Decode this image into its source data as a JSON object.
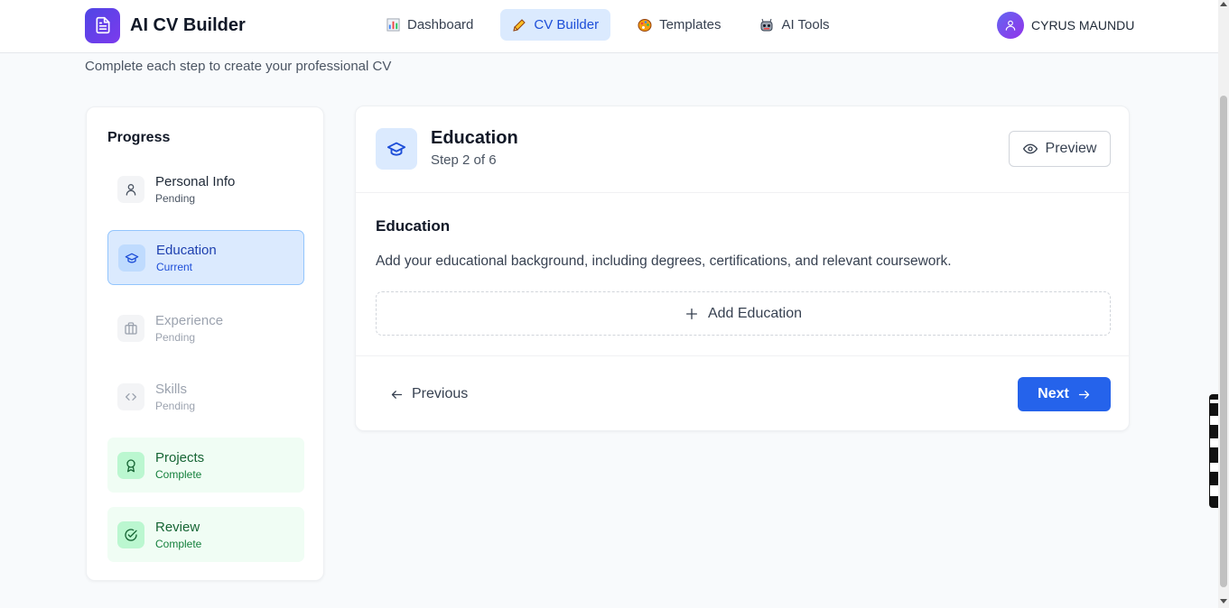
{
  "app": {
    "title": "AI CV Builder"
  },
  "nav": {
    "items": [
      {
        "label": "Dashboard",
        "icon": "bar-chart-icon",
        "active": false
      },
      {
        "label": "CV Builder",
        "icon": "pencil-icon",
        "active": true
      },
      {
        "label": "Templates",
        "icon": "palette-icon",
        "active": false
      },
      {
        "label": "AI Tools",
        "icon": "robot-icon",
        "active": false
      }
    ]
  },
  "user": {
    "name": "CYRUS MAUNDU"
  },
  "page": {
    "subtitle": "Complete each step to create your professional CV"
  },
  "sidebar": {
    "title": "Progress",
    "steps": [
      {
        "label": "Personal Info",
        "status": "Pending",
        "icon": "user-icon",
        "state": "pending"
      },
      {
        "label": "Education",
        "status": "Current",
        "icon": "graduation-cap-icon",
        "state": "current"
      },
      {
        "label": "Experience",
        "status": "Pending",
        "icon": "briefcase-icon",
        "state": "pending"
      },
      {
        "label": "Skills",
        "status": "Pending",
        "icon": "code-icon",
        "state": "pending"
      },
      {
        "label": "Projects",
        "status": "Complete",
        "icon": "award-icon",
        "state": "complete"
      },
      {
        "label": "Review",
        "status": "Complete",
        "icon": "check-circle-icon",
        "state": "complete"
      }
    ]
  },
  "main": {
    "header": {
      "title": "Education",
      "step": "Step 2 of 6",
      "preview_label": "Preview"
    },
    "section": {
      "title": "Education",
      "description": "Add your educational background, including degrees, certifications, and relevant coursework."
    },
    "add_label": "Add Education",
    "footer": {
      "previous_label": "Previous",
      "next_label": "Next"
    }
  },
  "colors": {
    "accent": "#2563eb",
    "brand_from": "#4f46e5",
    "brand_to": "#7c3aed",
    "complete": "#166534"
  }
}
